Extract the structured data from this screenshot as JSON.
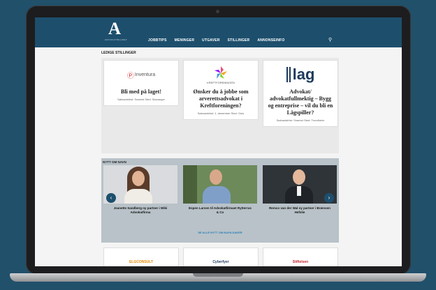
{
  "header": {
    "logo": "A",
    "logo_sub": "ADVOKATBLADET",
    "nav": [
      "JOBBTIPS",
      "MENINGER",
      "UTGAVER",
      "STILLINGER",
      "ANNONSEINFO"
    ]
  },
  "sections": {
    "jobs_title": "LEDIGE STILLINGER",
    "people_title": "NYTT OM NAVN",
    "people_more": "SE ALLE NYTT OM NAVN-SAKER"
  },
  "jobs": [
    {
      "logo": "Inventura",
      "title": "Bli med på laget!",
      "meta": "Søknadsfrist: Snarest Sted: Stavanger"
    },
    {
      "logo": "KREFTFORENINGEN",
      "title": "Ønsker du å jobbe som arverettsadvokat i Kreftforeningen?",
      "meta": "Søknadsfrist: 1. desember Sted: Oslo"
    },
    {
      "logo": "lag",
      "title": "Advokat/ advokatfullmektig – Bygg og entreprise – vil du bli en Lågspiller?",
      "meta": "Søknadsfrist: Snarest Sted: Trondheim"
    }
  ],
  "people": [
    {
      "name": "Jeanette Sandberg ny partner i Wiki Advokatfirma"
    },
    {
      "name": "Espen Larsen til Advokatfirmaet Rytterrus & Co"
    },
    {
      "name": "Remco van der Wal ny partner i Brænsen Hefslie"
    }
  ],
  "bottom_logos": [
    "ELGCONSULT",
    "Cyberfyer",
    "Stiftelsen"
  ],
  "colors": {
    "header": "#1d4f6d",
    "background": "#21506a",
    "people_band": "#b8c2c8"
  }
}
